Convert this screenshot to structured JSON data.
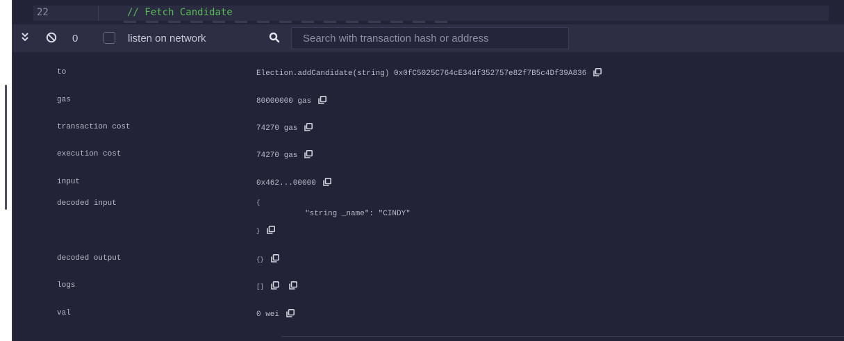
{
  "editor": {
    "line_number": "22",
    "code": "// Fetch Candidate"
  },
  "toolbar": {
    "count": "0",
    "listen_label": "listen on network",
    "search_placeholder": "Search with transaction hash or address"
  },
  "details": {
    "to": {
      "label": "to",
      "value": "Election.addCandidate(string) 0x0fC5025C764cE34df352757e82f7B5c4Df39A836"
    },
    "gas": {
      "label": "gas",
      "value": "80000000 gas"
    },
    "transaction_cost": {
      "label": "transaction cost",
      "value": "74270 gas"
    },
    "execution_cost": {
      "label": "execution cost",
      "value": "74270 gas"
    },
    "input": {
      "label": "input",
      "value": "0x462...00000"
    },
    "decoded_input": {
      "label": "decoded input",
      "open": "{",
      "line": "\"string _name\": \"CINDY\"",
      "close": "}"
    },
    "decoded_output": {
      "label": "decoded output",
      "value": "{}"
    },
    "logs": {
      "label": "logs",
      "value": "[]"
    },
    "val": {
      "label": "val",
      "value": "0 wei"
    }
  },
  "icons": {
    "collapse": "double-chevron-down-icon",
    "clear": "ban-icon",
    "search": "search-icon",
    "copy": "copy-icon"
  },
  "colors": {
    "background": "#222336",
    "toolbar": "#2d2e44",
    "comment": "#58b958",
    "text": "#b9bac9"
  }
}
